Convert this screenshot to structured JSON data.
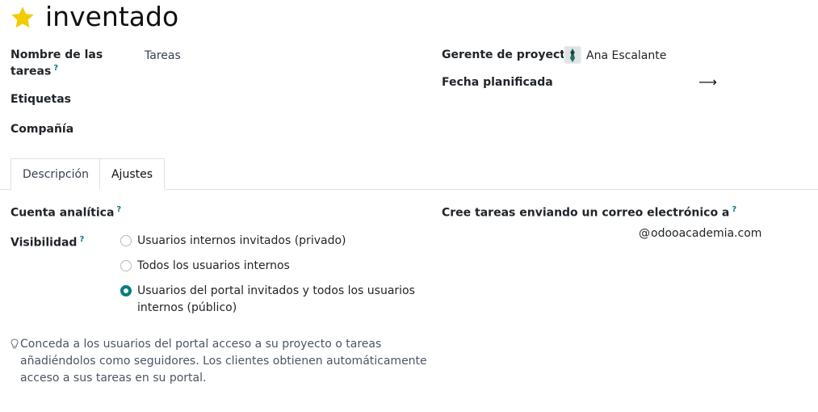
{
  "record": {
    "title": "inventado",
    "favorite_icon": "star-icon"
  },
  "fields_left": {
    "task_name_label_line1": "Nombre de las",
    "task_name_label_line2": "tareas",
    "task_name_help": "?",
    "task_name_value": "Tareas",
    "tags_label": "Etiquetas",
    "company_label": "Compañía"
  },
  "fields_right": {
    "manager_label": "Gerente de proyecto",
    "manager_value": "Ana Escalante",
    "planned_date_label": "Fecha planificada",
    "planned_date_arrow": "⟶"
  },
  "tabs": [
    {
      "label": "Descripción",
      "active": false
    },
    {
      "label": "Ajustes",
      "active": true
    }
  ],
  "settings": {
    "analytic_label": "Cuenta analítica",
    "analytic_help": "?",
    "visibility_label": "Visibilidad",
    "visibility_help": "?",
    "visibility_options": [
      {
        "label": "Usuarios internos invitados (privado)",
        "checked": false
      },
      {
        "label": "Todos los usuarios internos",
        "checked": false
      },
      {
        "label_line1": "Usuarios del portal invitados y todos los usuarios",
        "label_line2": "internos (público)",
        "checked": true
      }
    ],
    "hint_line1": "Conceda a los usuarios del portal acceso a su proyecto o tareas",
    "hint_line2": "añadiéndolos como seguidores. Los clientes obtienen automáticamente",
    "hint_line3": "acceso a sus tareas en su portal.",
    "email_label": "Cree tareas enviando un correo electrónico a",
    "email_help": "?",
    "email_at": "@",
    "email_domain": "odooacademia.com"
  },
  "colors": {
    "accent": "#017e84",
    "star": "#f3cc00"
  }
}
